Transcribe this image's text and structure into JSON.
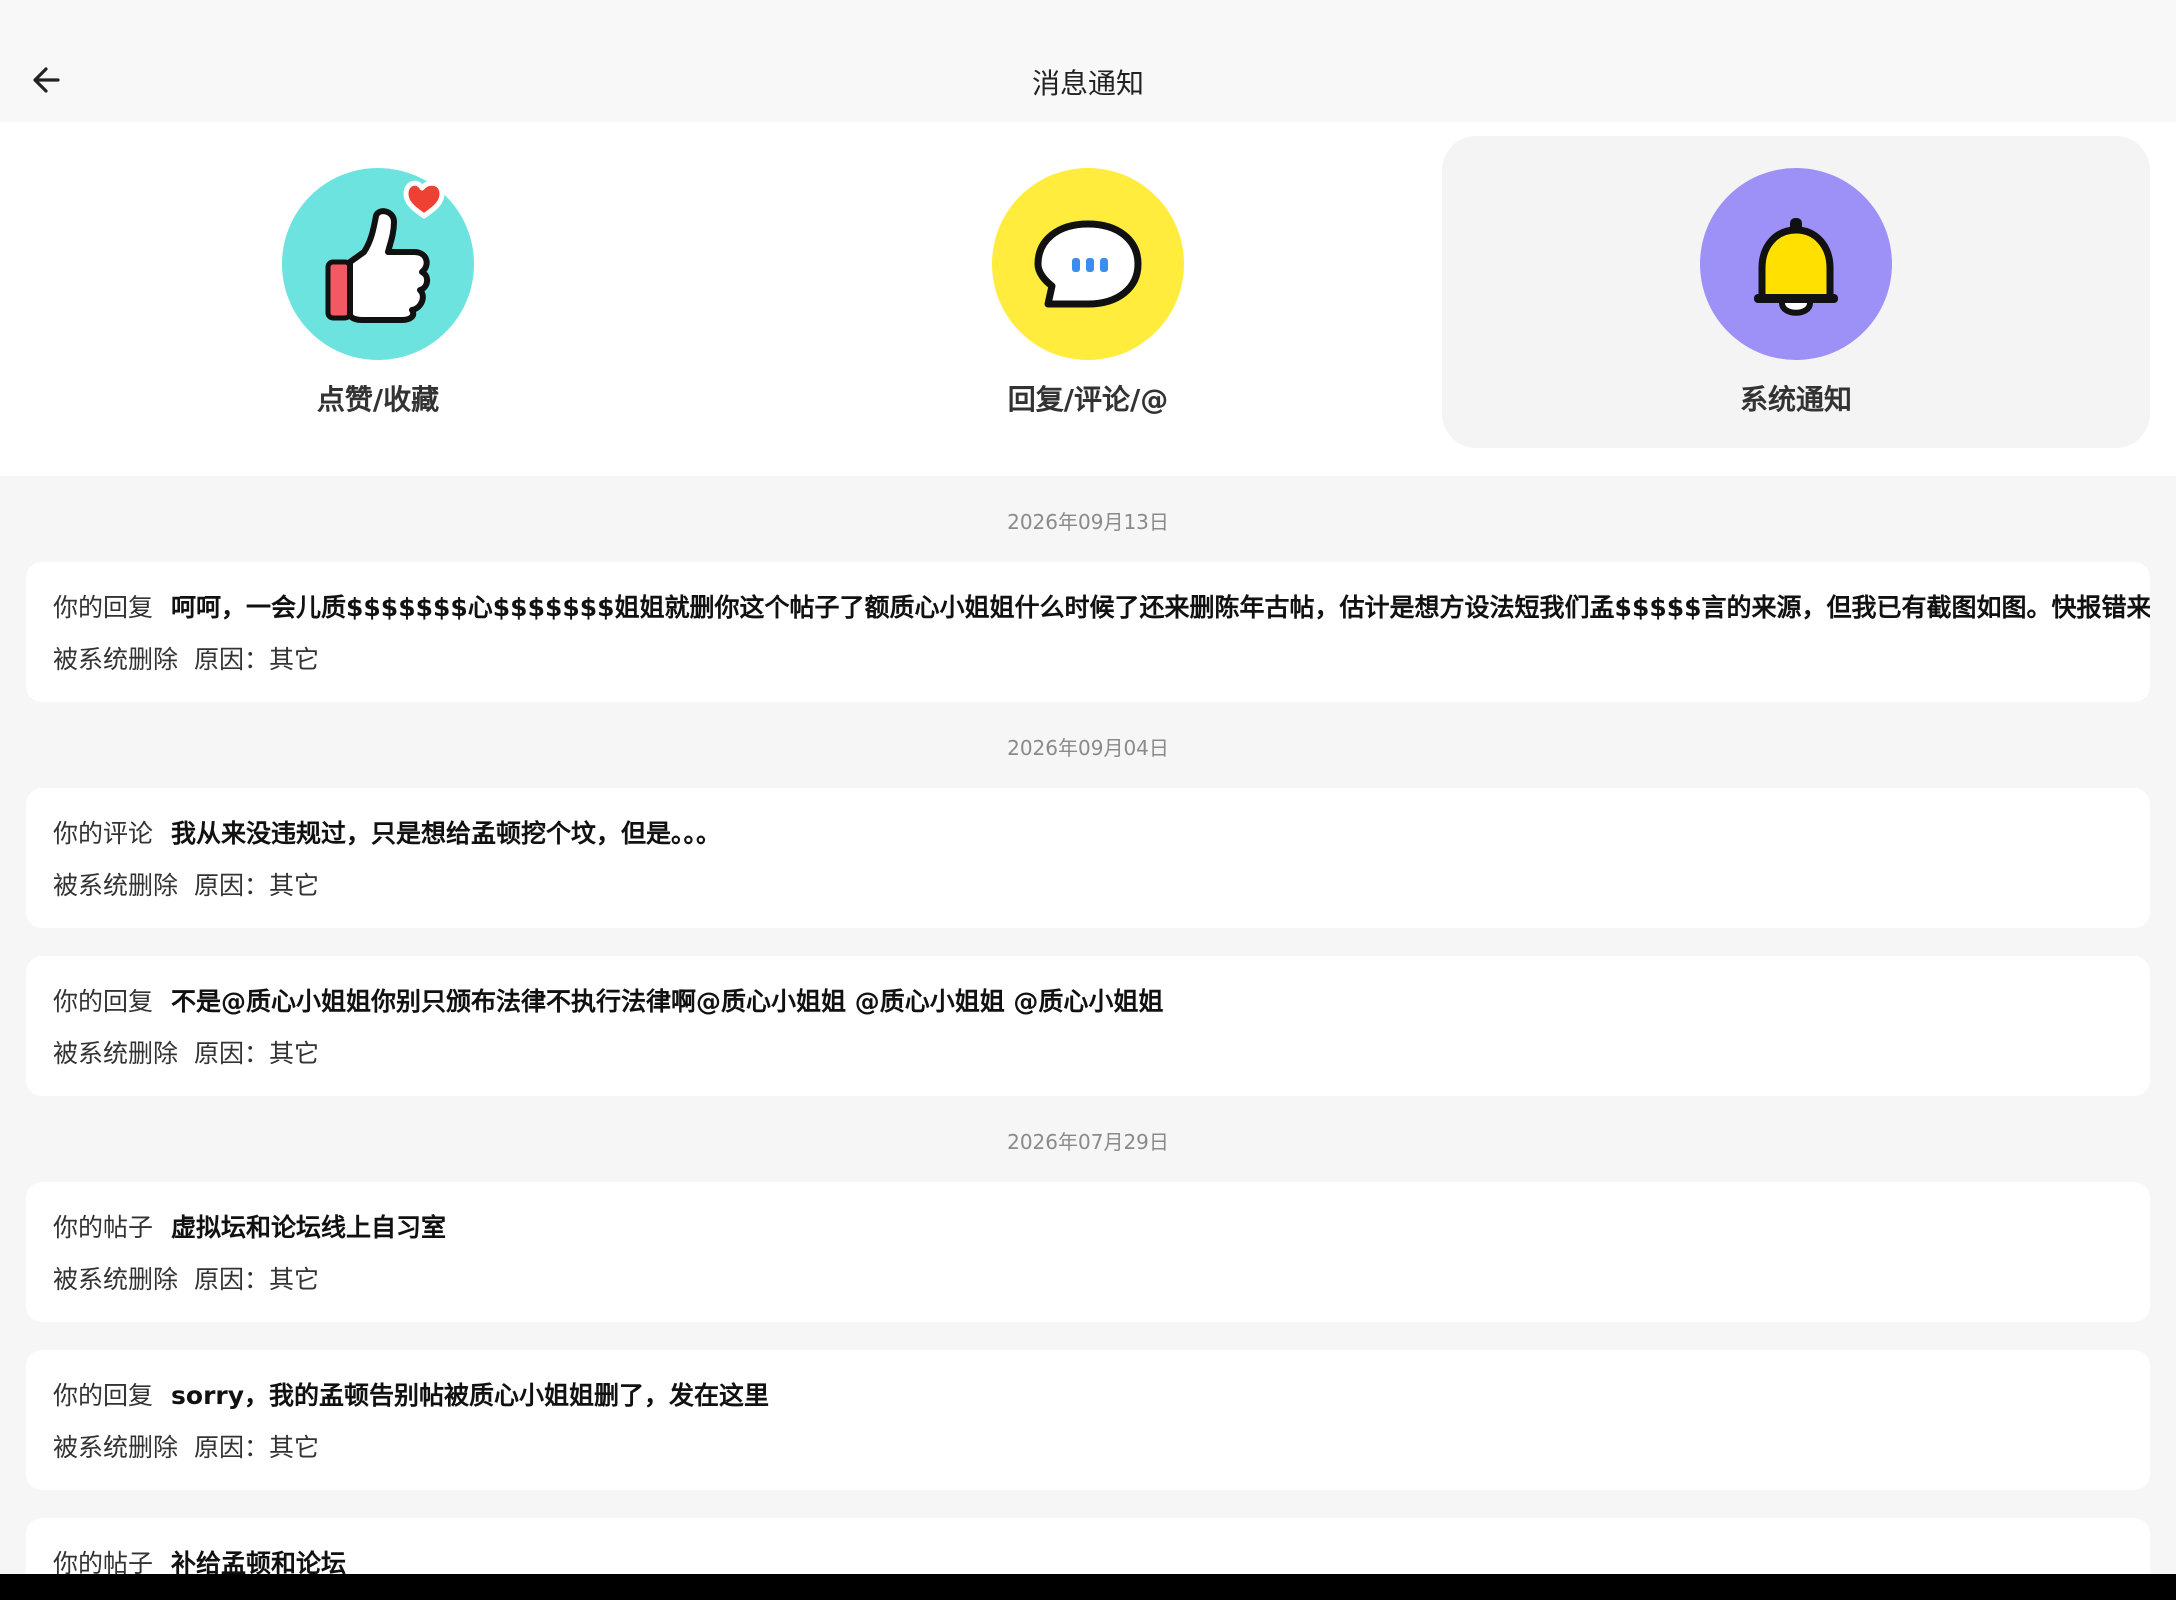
{
  "header": {
    "title": "消息通知"
  },
  "categories": [
    {
      "label": "点赞/收藏",
      "icon": "thumbs-up-heart-icon",
      "color": "#6de3df",
      "active": false
    },
    {
      "label": "回复/评论/@",
      "icon": "chat-bubble-icon",
      "color": "#ffec3d",
      "active": false
    },
    {
      "label": "系统通知",
      "icon": "bell-icon",
      "color": "#9d90f6",
      "active": true
    }
  ],
  "dates": [
    "2026年09月13日",
    "2026年09月04日",
    "2026年07月29日"
  ],
  "notifications": [
    {
      "kind": "你的回复",
      "content": "呵呵，一会儿质$$$$$$$心$$$$$$$姐姐就删你这个帖子了额质心小姐姐什么时候了还来删陈年古帖，估计是想方设法短我们孟$$$$$言的来源，但我已有截图如图。快报错来吧一会这条回",
      "status": "被系统删除",
      "reason": "原因：其它"
    },
    {
      "kind": "你的评论",
      "content": "我从来没违规过，只是想给孟顿挖个坟，但是。。。",
      "status": "被系统删除",
      "reason": "原因：其它"
    },
    {
      "kind": "你的回复",
      "content": "不是@质心小姐姐你别只颁布法律不执行法律啊@质心小姐姐 @质心小姐姐 @质心小姐姐",
      "status": "被系统删除",
      "reason": "原因：其它"
    },
    {
      "kind": "你的帖子",
      "content": "虚拟坛和论坛线上自习室",
      "status": "被系统删除",
      "reason": "原因：其它"
    },
    {
      "kind": "你的回复",
      "content": "sorry，我的孟顿告别帖被质心小姐姐删了，发在这里",
      "status": "被系统删除",
      "reason": "原因：其它"
    },
    {
      "kind": "你的帖子",
      "content": "补给孟顿和论坛",
      "status": "",
      "reason": ""
    }
  ]
}
